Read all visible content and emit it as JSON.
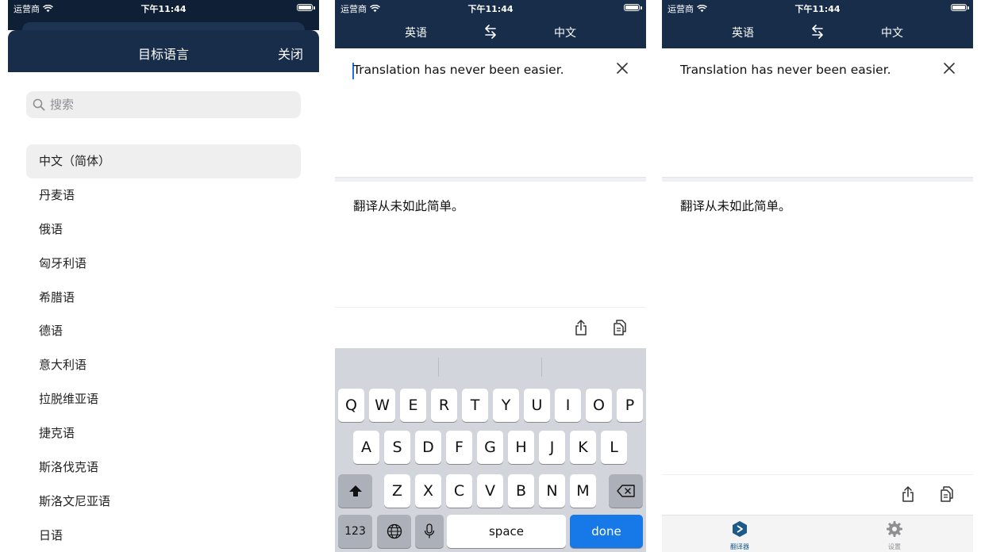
{
  "status": {
    "carrier": "运营商",
    "time": "下午11:44"
  },
  "picker": {
    "title": "目标语言",
    "close_label": "关闭",
    "search_placeholder": "搜索",
    "languages": [
      "中文（简体）",
      "丹麦语",
      "俄语",
      "匈牙利语",
      "希腊语",
      "德语",
      "意大利语",
      "拉脱维亚语",
      "捷克语",
      "斯洛伐克语",
      "斯洛文尼亚语",
      "日语"
    ],
    "selected_index": 0
  },
  "translator": {
    "source_lang": "英语",
    "target_lang": "中文",
    "input_text": "Translation has never been easier.",
    "output_text": "翻译从未如此简单。"
  },
  "keyboard": {
    "row1": [
      "Q",
      "W",
      "E",
      "R",
      "T",
      "Y",
      "U",
      "I",
      "O",
      "P"
    ],
    "row2": [
      "A",
      "S",
      "D",
      "F",
      "G",
      "H",
      "J",
      "K",
      "L"
    ],
    "row3": [
      "Z",
      "X",
      "C",
      "V",
      "B",
      "N",
      "M"
    ],
    "numbers_label": "123",
    "space_label": "space",
    "done_label": "done"
  },
  "tabs": {
    "translator_label": "翻译器",
    "settings_label": "设置"
  },
  "colors": {
    "navy": "#172d4a",
    "accent_blue": "#1779e8",
    "tab_active": "#1b5a8a",
    "tab_inactive": "#8e8e93"
  },
  "icons": [
    "wifi-icon",
    "battery-icon",
    "search-icon",
    "swap-icon",
    "close-icon",
    "share-icon",
    "copy-icon",
    "shift-icon",
    "backspace-icon",
    "globe-icon",
    "microphone-icon",
    "translator-tab-icon",
    "settings-gear-icon"
  ]
}
